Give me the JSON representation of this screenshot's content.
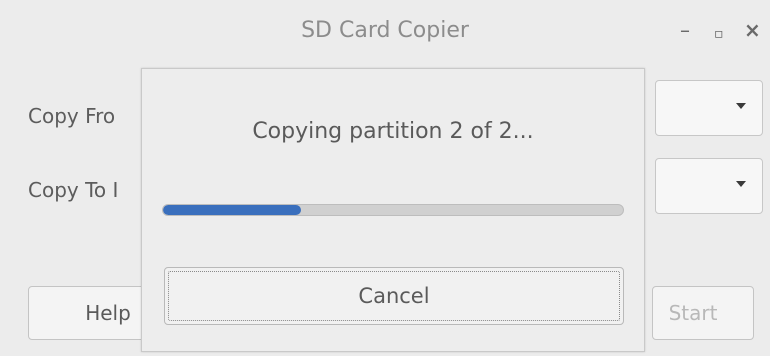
{
  "window": {
    "title": "SD Card Copier",
    "minimize_glyph": "–",
    "maximize_glyph": "▫",
    "close_glyph": "×"
  },
  "form": {
    "copy_from_label": "Copy Fro",
    "copy_to_label": "Copy To I",
    "help_label": "Help",
    "start_label": "Start"
  },
  "dialog": {
    "status_text": "Copying partition 2 of 2...",
    "progress_fraction": 0.3,
    "cancel_label": "Cancel"
  },
  "colors": {
    "progress_fill": "#3a6fbd",
    "background": "#ececec"
  }
}
